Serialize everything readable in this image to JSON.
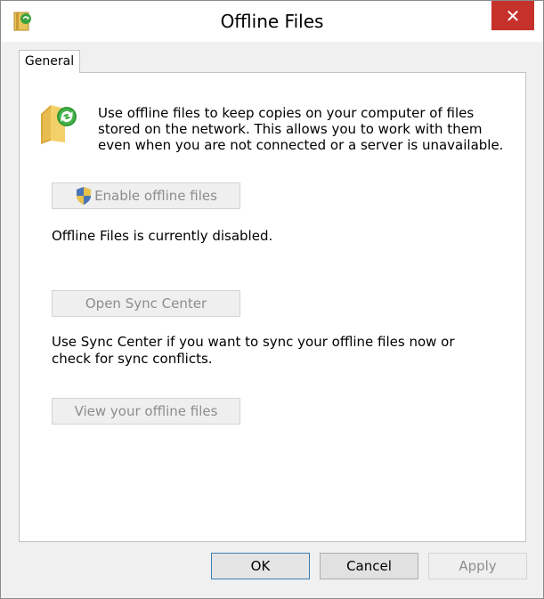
{
  "window": {
    "title": "Offline Files",
    "close_glyph": "✕"
  },
  "tabs": [
    {
      "label": "General"
    }
  ],
  "general": {
    "intro_text": "Use offline files to keep copies on your computer of files stored on the network.  This allows you to work with them even when you are not connected or a server is unavailable.",
    "enable_button_label": "Enable offline files",
    "status_text": "Offline Files is currently disabled.",
    "open_sync_button_label": "Open Sync Center",
    "sync_description": "Use Sync Center if you want to sync your offline files now or check for sync conflicts.",
    "view_files_button_label": "View your offline files"
  },
  "footer": {
    "ok_label": "OK",
    "cancel_label": "Cancel",
    "apply_label": "Apply"
  },
  "icons": {
    "app": "offline-files-icon",
    "folder": "folder-sync-icon",
    "shield": "uac-shield-icon",
    "close": "close-icon"
  },
  "colors": {
    "close_button": "#c7312b",
    "ok_border": "#3c7fb1",
    "disabled_text": "#8d8d8d"
  }
}
